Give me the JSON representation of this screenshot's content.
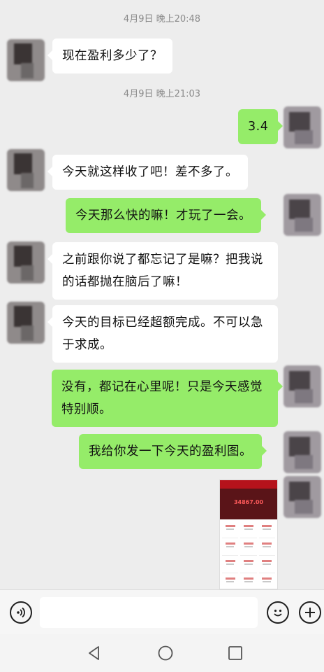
{
  "timestamps": [
    "4月9日 晚上20:48",
    "4月9日 晚上21:03"
  ],
  "messages": [
    {
      "side": "in",
      "text": "现在盈利多少了？"
    },
    {
      "side": "out",
      "text": "3.4"
    },
    {
      "side": "in",
      "text": "今天就这样收了吧！差不多了。"
    },
    {
      "side": "out",
      "text": "今天那么快的嘛！才玩了一会。"
    },
    {
      "side": "in",
      "text": "之前跟你说了都忘记了是嘛？把我说的话都抛在脑后了嘛！"
    },
    {
      "side": "in",
      "text": "今天的目标已经超额完成。不可以急于求成。"
    },
    {
      "side": "out",
      "text": "没有，都记在心里呢！只是今天感觉特别顺。"
    },
    {
      "side": "out",
      "text": "我给你发一下今天的盈利图。"
    }
  ],
  "profit_image": {
    "amount": "34867.00"
  },
  "input_bar": {
    "placeholder": ""
  },
  "icons": {
    "voice": "voice-icon",
    "emoji": "emoji-icon",
    "plus": "plus-icon",
    "nav_back": "back-triangle-icon",
    "nav_home": "home-circle-icon",
    "nav_recent": "recent-square-icon"
  },
  "colors": {
    "background": "#ededed",
    "incoming_bubble": "#ffffff",
    "outgoing_bubble": "#95ec69",
    "timestamp": "#8a8a8a"
  }
}
